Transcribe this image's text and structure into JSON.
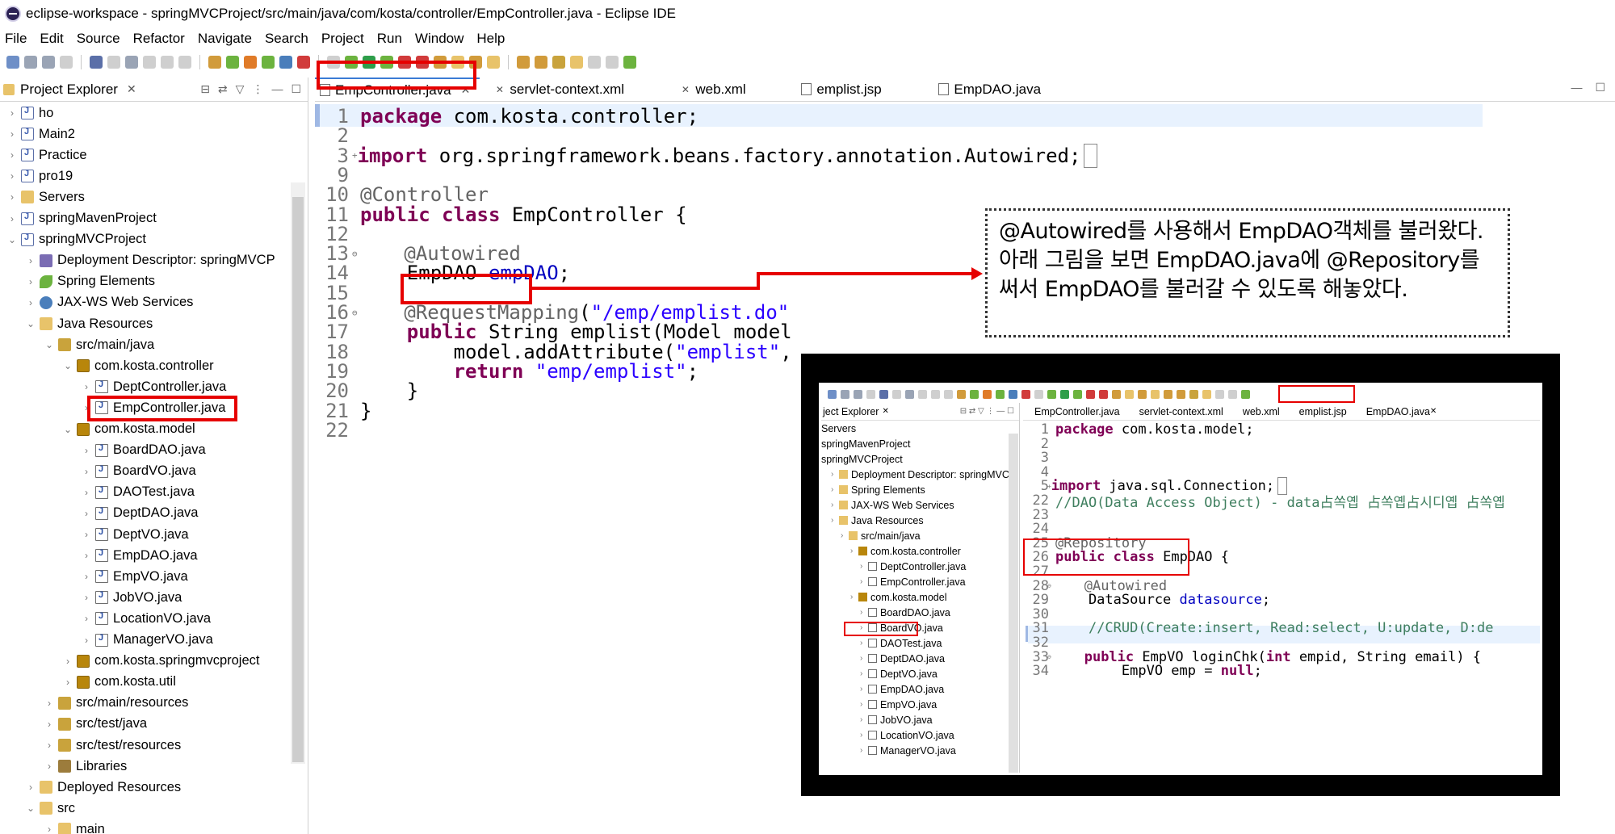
{
  "window": {
    "title": "eclipse-workspace - springMVCProject/src/main/java/com/kosta/controller/EmpController.java - Eclipse IDE"
  },
  "menu": [
    "File",
    "Edit",
    "Source",
    "Refactor",
    "Navigate",
    "Search",
    "Project",
    "Run",
    "Window",
    "Help"
  ],
  "project_explorer": {
    "tab_label": "Project Explorer",
    "items": [
      {
        "label": "ho",
        "icon": "project-icon",
        "chevron": "›"
      },
      {
        "label": "Main2",
        "icon": "project-icon",
        "chevron": "›"
      },
      {
        "label": "Practice",
        "icon": "project-icon",
        "chevron": "›"
      },
      {
        "label": "pro19",
        "icon": "project-icon",
        "chevron": "›"
      },
      {
        "label": "Servers",
        "icon": "folder-icon",
        "chevron": "›"
      },
      {
        "label": "springMavenProject",
        "icon": "project-icon",
        "chevron": "›"
      },
      {
        "label": "springMVCProject",
        "icon": "project-icon",
        "chevron": "⌄"
      },
      {
        "label": "Deployment Descriptor: springMVCP",
        "icon": "descriptor-icon",
        "chevron": "›"
      },
      {
        "label": "Spring Elements",
        "icon": "spring-leaf-icon",
        "chevron": "›"
      },
      {
        "label": "JAX-WS Web Services",
        "icon": "webservice-icon",
        "chevron": "›"
      },
      {
        "label": "Java Resources",
        "icon": "java-resources-icon",
        "chevron": "⌄"
      },
      {
        "label": "src/main/java",
        "icon": "source-folder-icon",
        "chevron": "⌄"
      },
      {
        "label": "com.kosta.controller",
        "icon": "package-icon",
        "chevron": "⌄"
      },
      {
        "label": "DeptController.java",
        "icon": "java-file-icon",
        "chevron": "›"
      },
      {
        "label": "EmpController.java",
        "icon": "java-file-icon",
        "chevron": "›"
      },
      {
        "label": "com.kosta.model",
        "icon": "package-icon",
        "chevron": "⌄"
      },
      {
        "label": "BoardDAO.java",
        "icon": "java-file-icon",
        "chevron": "›"
      },
      {
        "label": "BoardVO.java",
        "icon": "java-file-icon",
        "chevron": "›"
      },
      {
        "label": "DAOTest.java",
        "icon": "java-file-icon",
        "chevron": "›"
      },
      {
        "label": "DeptDAO.java",
        "icon": "java-file-icon",
        "chevron": "›"
      },
      {
        "label": "DeptVO.java",
        "icon": "java-file-icon",
        "chevron": "›"
      },
      {
        "label": "EmpDAO.java",
        "icon": "java-file-icon",
        "chevron": "›"
      },
      {
        "label": "EmpVO.java",
        "icon": "java-file-icon",
        "chevron": "›"
      },
      {
        "label": "JobVO.java",
        "icon": "java-file-icon",
        "chevron": "›"
      },
      {
        "label": "LocationVO.java",
        "icon": "java-file-icon",
        "chevron": "›"
      },
      {
        "label": "ManagerVO.java",
        "icon": "java-file-icon",
        "chevron": "›"
      },
      {
        "label": "com.kosta.springmvcproject",
        "icon": "package-icon",
        "chevron": "›"
      },
      {
        "label": "com.kosta.util",
        "icon": "package-icon",
        "chevron": "›"
      },
      {
        "label": "src/main/resources",
        "icon": "source-folder-icon",
        "chevron": "›"
      },
      {
        "label": "src/test/java",
        "icon": "source-folder-icon",
        "chevron": "›"
      },
      {
        "label": "src/test/resources",
        "icon": "source-folder-icon",
        "chevron": "›"
      },
      {
        "label": "Libraries",
        "icon": "library-icon",
        "chevron": "›"
      },
      {
        "label": "Deployed Resources",
        "icon": "folder-icon",
        "chevron": "›"
      },
      {
        "label": "src",
        "icon": "folder-icon",
        "chevron": "⌄"
      },
      {
        "label": "main",
        "icon": "folder-icon",
        "chevron": "›"
      }
    ]
  },
  "editor": {
    "tabs": [
      "EmpController.java",
      "servlet-context.xml",
      "web.xml",
      "emplist.jsp",
      "EmpDAO.java"
    ],
    "close_glyph": "✕",
    "lines": [
      {
        "n": "1",
        "parts": [
          [
            "kw",
            "package"
          ],
          [
            "",
            " com.kosta.controller;"
          ]
        ]
      },
      {
        "n": "2",
        "parts": []
      },
      {
        "n": "3",
        "fold": "+",
        "parts": [
          [
            "kw",
            "import"
          ],
          [
            "",
            " org.springframework.beans.factory.annotation.Autowired;"
          ],
          [
            "box",
            " "
          ]
        ]
      },
      {
        "n": "9",
        "parts": []
      },
      {
        "n": "10",
        "parts": [
          [
            "ann",
            "@Controller"
          ]
        ]
      },
      {
        "n": "11",
        "parts": [
          [
            "kw",
            "public"
          ],
          [
            "",
            " "
          ],
          [
            "kw",
            "class"
          ],
          [
            "",
            " EmpController {"
          ]
        ]
      },
      {
        "n": "12",
        "parts": []
      },
      {
        "n": "13",
        "fold": "⊖",
        "parts": [
          [
            "",
            "    "
          ],
          [
            "ann",
            "@Autowired"
          ]
        ]
      },
      {
        "n": "14",
        "parts": [
          [
            "",
            "    EmpDAO "
          ],
          [
            "fld",
            "empDAO"
          ],
          [
            "",
            ";"
          ]
        ]
      },
      {
        "n": "15",
        "parts": []
      },
      {
        "n": "16",
        "fold": "⊖",
        "parts": [
          [
            "",
            "    "
          ],
          [
            "ann",
            "@RequestMapping"
          ],
          [
            "",
            "("
          ],
          [
            "str",
            "\"/emp/emplist.do\""
          ]
        ]
      },
      {
        "n": "17",
        "parts": [
          [
            "",
            "    "
          ],
          [
            "kw",
            "public"
          ],
          [
            "",
            " String emplist(Model model"
          ]
        ]
      },
      {
        "n": "18",
        "parts": [
          [
            "",
            "        model.addAttribute("
          ],
          [
            "str",
            "\"emplist\""
          ],
          [
            "",
            ", "
          ]
        ]
      },
      {
        "n": "19",
        "parts": [
          [
            "",
            "        "
          ],
          [
            "kw",
            "return"
          ],
          [
            "",
            " "
          ],
          [
            "str",
            "\"emp/emplist\""
          ],
          [
            "",
            ";"
          ]
        ]
      },
      {
        "n": "20",
        "parts": [
          [
            "",
            "    }"
          ]
        ]
      },
      {
        "n": "21",
        "parts": [
          [
            "",
            "}"
          ]
        ]
      },
      {
        "n": "22",
        "parts": []
      }
    ]
  },
  "callout": {
    "text": "@Autowired를 사용해서 EmpDAO객체를 불러왔다.\n아래 그림을 보면 EmpDAO.java에 @Repository를 써서 EmpDAO를 불러갈 수 있도록 해놓았다."
  },
  "inset": {
    "explorer_tab": "ject Explorer",
    "tabs": [
      "EmpController.java",
      "servlet-context.xml",
      "web.xml",
      "emplist.jsp",
      "EmpDAO.java"
    ],
    "tree": [
      {
        "label": "Servers",
        "indent": 0
      },
      {
        "label": "springMavenProject",
        "indent": 0
      },
      {
        "label": "springMVCProject",
        "indent": 0
      },
      {
        "label": "Deployment Descriptor: springMVCP",
        "indent": 1
      },
      {
        "label": "Spring Elements",
        "indent": 1
      },
      {
        "label": "JAX-WS Web Services",
        "indent": 1
      },
      {
        "label": "Java Resources",
        "indent": 1
      },
      {
        "label": "src/main/java",
        "indent": 2
      },
      {
        "label": "com.kosta.controller",
        "indent": 3
      },
      {
        "label": "DeptController.java",
        "indent": 4
      },
      {
        "label": "EmpController.java",
        "indent": 4
      },
      {
        "label": "com.kosta.model",
        "indent": 3
      },
      {
        "label": "BoardDAO.java",
        "indent": 4
      },
      {
        "label": "BoardVO.java",
        "indent": 4
      },
      {
        "label": "DAOTest.java",
        "indent": 4
      },
      {
        "label": "DeptDAO.java",
        "indent": 4
      },
      {
        "label": "DeptVO.java",
        "indent": 4
      },
      {
        "label": "EmpDAO.java",
        "indent": 4
      },
      {
        "label": "EmpVO.java",
        "indent": 4
      },
      {
        "label": "JobVO.java",
        "indent": 4
      },
      {
        "label": "LocationVO.java",
        "indent": 4
      },
      {
        "label": "ManagerVO.java",
        "indent": 4
      }
    ],
    "lines": [
      {
        "n": "1",
        "parts": [
          [
            "kw",
            "package"
          ],
          [
            "",
            " com.kosta.model;"
          ]
        ]
      },
      {
        "n": "2",
        "parts": []
      },
      {
        "n": "3",
        "parts": []
      },
      {
        "n": "4",
        "parts": []
      },
      {
        "n": "5",
        "fold": "+",
        "parts": [
          [
            "kw",
            "import"
          ],
          [
            "",
            " java.sql.Connection;"
          ],
          [
            "box",
            " "
          ]
        ]
      },
      {
        "n": "22",
        "parts": [
          [
            "cmt",
            "//DAO(Data Access Object) - data占쏙옙 占쏙옙占시디옙 占쏙옙"
          ]
        ]
      },
      {
        "n": "23",
        "parts": []
      },
      {
        "n": "24",
        "parts": []
      },
      {
        "n": "25",
        "parts": [
          [
            "ann",
            "@Repository"
          ]
        ]
      },
      {
        "n": "26",
        "parts": [
          [
            "kw",
            "public"
          ],
          [
            "",
            " "
          ],
          [
            "kw",
            "class"
          ],
          [
            "",
            " EmpDAO {"
          ]
        ]
      },
      {
        "n": "27",
        "parts": []
      },
      {
        "n": "28",
        "fold": "⊖",
        "parts": [
          [
            "",
            "    "
          ],
          [
            "ann",
            "@Autowired"
          ]
        ]
      },
      {
        "n": "29",
        "parts": [
          [
            "",
            "    DataSource "
          ],
          [
            "fld",
            "datasource"
          ],
          [
            "",
            ";"
          ]
        ]
      },
      {
        "n": "30",
        "parts": []
      },
      {
        "n": "31",
        "parts": [
          [
            "",
            "    "
          ],
          [
            "cmt",
            "//CRUD(Create:insert, Read:select, U:update, D:de"
          ]
        ]
      },
      {
        "n": "32",
        "parts": []
      },
      {
        "n": "33",
        "fold": "⊖",
        "parts": [
          [
            "",
            "    "
          ],
          [
            "kw",
            "public"
          ],
          [
            "",
            " EmpVO loginChk("
          ],
          [
            "kw",
            "int"
          ],
          [
            "",
            " empid, String email) {"
          ]
        ]
      },
      {
        "n": "34",
        "parts": [
          [
            "",
            "        EmpVO emp = "
          ],
          [
            "kw",
            "null"
          ],
          [
            "",
            ";"
          ]
        ]
      }
    ]
  }
}
